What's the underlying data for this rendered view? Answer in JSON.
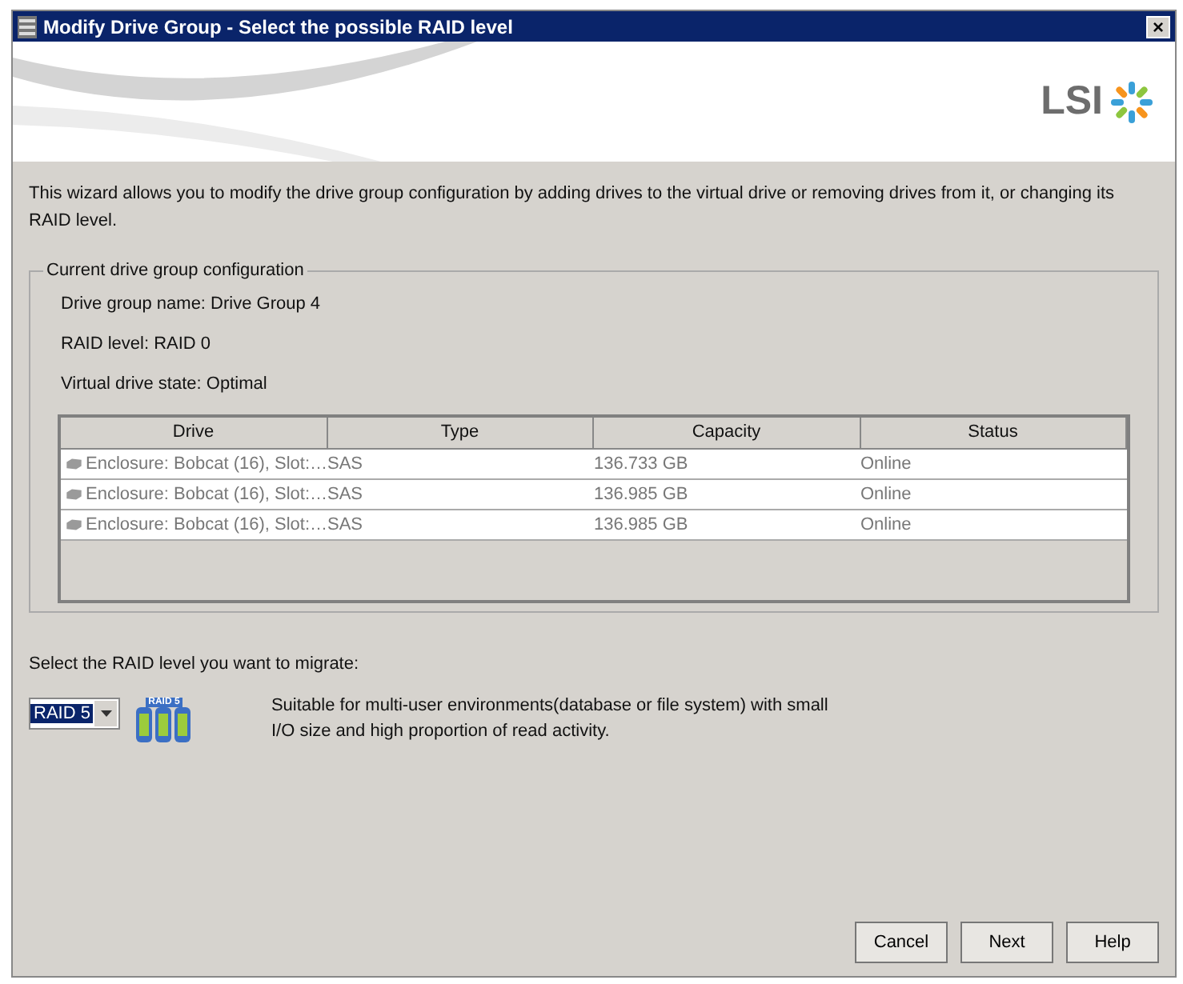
{
  "window": {
    "title": "Modify Drive Group - Select the possible RAID level",
    "close": "×"
  },
  "logo": {
    "text": "LSI"
  },
  "intro": "This wizard allows you to modify the drive group configuration by adding drives to the virtual drive or removing drives from it, or changing its RAID level.",
  "group": {
    "legend": "Current drive group configuration",
    "fields": [
      "Drive group name: Drive Group 4",
      "RAID level: RAID 0",
      "Virtual drive state: Optimal"
    ],
    "table": {
      "columns": [
        "Drive",
        "Type",
        "Capacity",
        "Status"
      ],
      "rows": [
        [
          "Enclosure: Bobcat (16), Slot:…",
          "SAS",
          "136.733 GB",
          "Online"
        ],
        [
          "Enclosure: Bobcat (16), Slot:…",
          "SAS",
          "136.985 GB",
          "Online"
        ],
        [
          "Enclosure: Bobcat (16), Slot:…",
          "SAS",
          "136.985 GB",
          "Online"
        ]
      ]
    }
  },
  "raid": {
    "prompt": "Select the RAID level you want to migrate:",
    "value": "RAID 5",
    "icon_label": "RAID 5",
    "description": "Suitable for multi-user environments(database or file system) with small I/O size and high proportion of read activity."
  },
  "buttons": [
    "Cancel",
    "Next",
    "Help"
  ]
}
